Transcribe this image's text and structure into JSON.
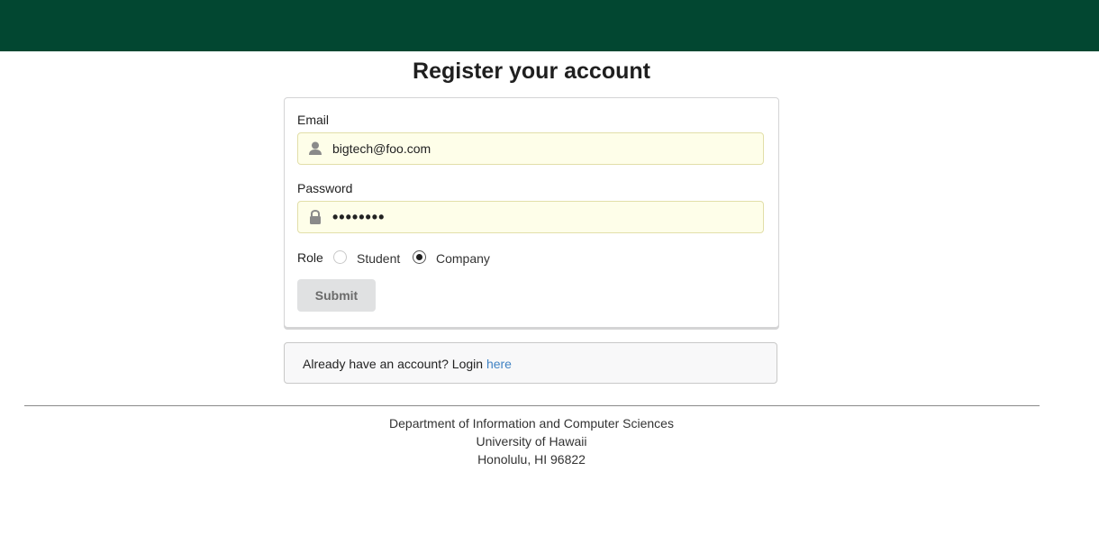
{
  "header": {
    "bar_color": "#024731"
  },
  "page": {
    "title": "Register your account"
  },
  "form": {
    "email_label": "Email",
    "email_value": "bigtech@foo.com",
    "email_icon": "user-icon",
    "password_label": "Password",
    "password_value": "••••••••",
    "password_icon": "lock-icon",
    "role_label": "Role",
    "role_options": [
      {
        "label": "Student",
        "checked": false
      },
      {
        "label": "Company",
        "checked": true
      }
    ],
    "submit_label": "Submit"
  },
  "login": {
    "message": "Already have an account? Login ",
    "link_text": "here",
    "link_color": "#4183c4"
  },
  "footer": {
    "line1": "Department of Information and Computer Sciences",
    "line2": "University of Hawaii",
    "line3": "Honolulu, HI 96822"
  }
}
